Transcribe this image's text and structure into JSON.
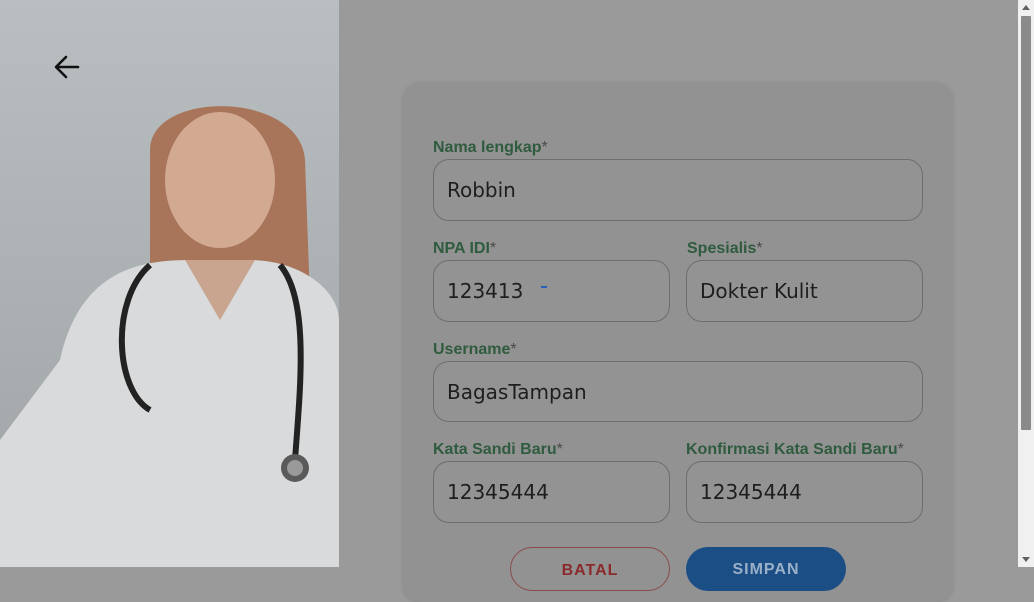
{
  "form": {
    "full_name": {
      "label": "Nama lengkap",
      "required_mark": "*",
      "value": "Robbin"
    },
    "npa_idi": {
      "label": "NPA IDI",
      "required_mark": "*",
      "value": "123413"
    },
    "specialist": {
      "label": "Spesialis",
      "required_mark": "*",
      "value": "Dokter Kulit"
    },
    "username": {
      "label": "Username",
      "required_mark": "*",
      "value": "BagasTampan"
    },
    "new_password": {
      "label": "Kata Sandi Baru",
      "required_mark": "*",
      "value": "12345444"
    },
    "confirm_password": {
      "label": "Konfirmasi Kata Sandi Baru",
      "required_mark": "*",
      "value": "12345444"
    }
  },
  "buttons": {
    "cancel_label": "BATAL",
    "save_label": "SIMPAN"
  },
  "icons": {
    "back": "arrow-left-icon"
  },
  "colors": {
    "label_green": "#2f5b3e",
    "save_blue": "#1c4e86",
    "cancel_red": "#8a2a2a"
  }
}
